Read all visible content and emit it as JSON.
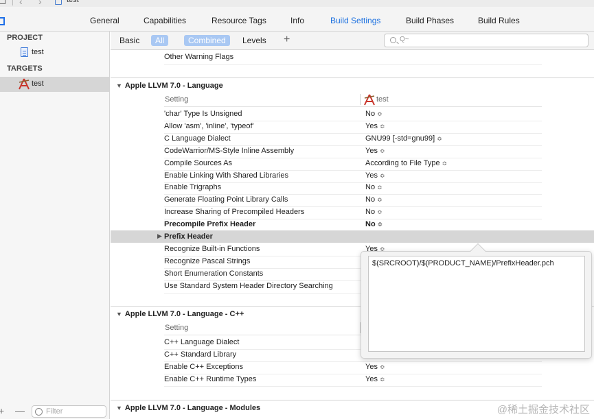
{
  "window": {
    "breadcrumb": "test"
  },
  "tabs": [
    {
      "label": "General",
      "active": false
    },
    {
      "label": "Capabilities",
      "active": false
    },
    {
      "label": "Resource Tags",
      "active": false
    },
    {
      "label": "Info",
      "active": false
    },
    {
      "label": "Build Settings",
      "active": true
    },
    {
      "label": "Build Phases",
      "active": false
    },
    {
      "label": "Build Rules",
      "active": false
    }
  ],
  "sidebar": {
    "project_title": "PROJECT",
    "project_item": "test",
    "targets_title": "TARGETS",
    "target_item": "test",
    "add": "+",
    "remove": "—",
    "filter_placeholder": "Filter"
  },
  "filterbar": {
    "basic": "Basic",
    "all": "All",
    "combined": "Combined",
    "levels": "Levels",
    "add": "+",
    "search_placeholder": "Q~"
  },
  "top_row": "Other Warning Flags",
  "groups": {
    "language": {
      "title": "Apple LLVM 7.0 - Language",
      "col_setting": "Setting",
      "col_target": "test",
      "rows": [
        {
          "name": "'char' Type Is Unsigned",
          "value": "No"
        },
        {
          "name": "Allow 'asm', 'inline', 'typeof'",
          "value": "Yes"
        },
        {
          "name": "C Language Dialect",
          "value": "GNU99 [-std=gnu99]"
        },
        {
          "name": "CodeWarrior/MS-Style Inline Assembly",
          "value": "Yes"
        },
        {
          "name": "Compile Sources As",
          "value": "According to File Type"
        },
        {
          "name": "Enable Linking With Shared Libraries",
          "value": "Yes"
        },
        {
          "name": "Enable Trigraphs",
          "value": "No"
        },
        {
          "name": "Generate Floating Point Library Calls",
          "value": "No"
        },
        {
          "name": "Increase Sharing of Precompiled Headers",
          "value": "No"
        },
        {
          "name": "Precompile Prefix Header",
          "value": "No"
        }
      ],
      "prefix_header": "Prefix Header",
      "rows_after": [
        {
          "name": "Recognize Built-in Functions",
          "value": "Yes"
        },
        {
          "name": "Recognize Pascal Strings",
          "value": ""
        },
        {
          "name": "Short Enumeration Constants",
          "value": ""
        },
        {
          "name": "Use Standard System Header Directory Searching",
          "value": ""
        }
      ]
    },
    "cpp": {
      "title": "Apple LLVM 7.0 - Language - C++",
      "col_setting": "Setting",
      "rows": [
        {
          "name": "C++ Language Dialect",
          "value": ""
        },
        {
          "name": "C++ Standard Library",
          "value": ""
        },
        {
          "name": "Enable C++ Exceptions",
          "value": "Yes"
        },
        {
          "name": "Enable C++ Runtime Types",
          "value": "Yes"
        }
      ]
    },
    "modules": {
      "title": "Apple LLVM 7.0 - Language - Modules"
    }
  },
  "popover": {
    "value": "$(SRCROOT)/$(PRODUCT_NAME)/PrefixHeader.pch"
  },
  "stepper_glyph": "≎",
  "watermark": "@稀土掘金技术社区",
  "icons": {
    "disclosure_open": "▼",
    "disclosure_closed": "▶"
  },
  "colors": {
    "accent": "#1b70e0",
    "selected_segment": "#a9c8f3"
  }
}
